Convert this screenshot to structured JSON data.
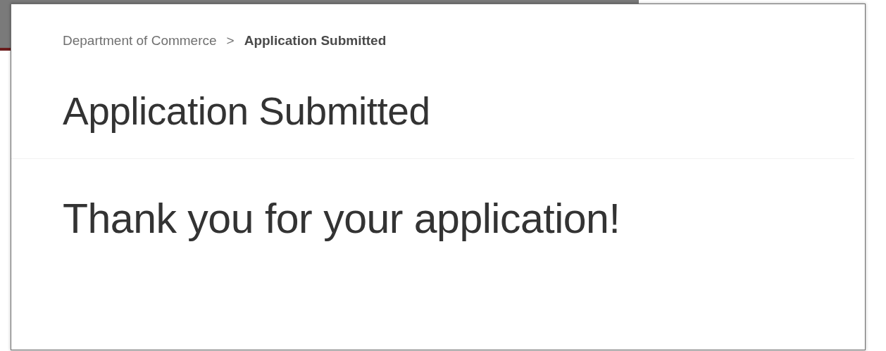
{
  "breadcrumb": {
    "items": [
      {
        "label": "Department of Commerce",
        "current": false
      },
      {
        "label": "Application Submitted",
        "current": true
      }
    ],
    "separator": ">"
  },
  "title": "Application Submitted",
  "message": "Thank you for your application!"
}
